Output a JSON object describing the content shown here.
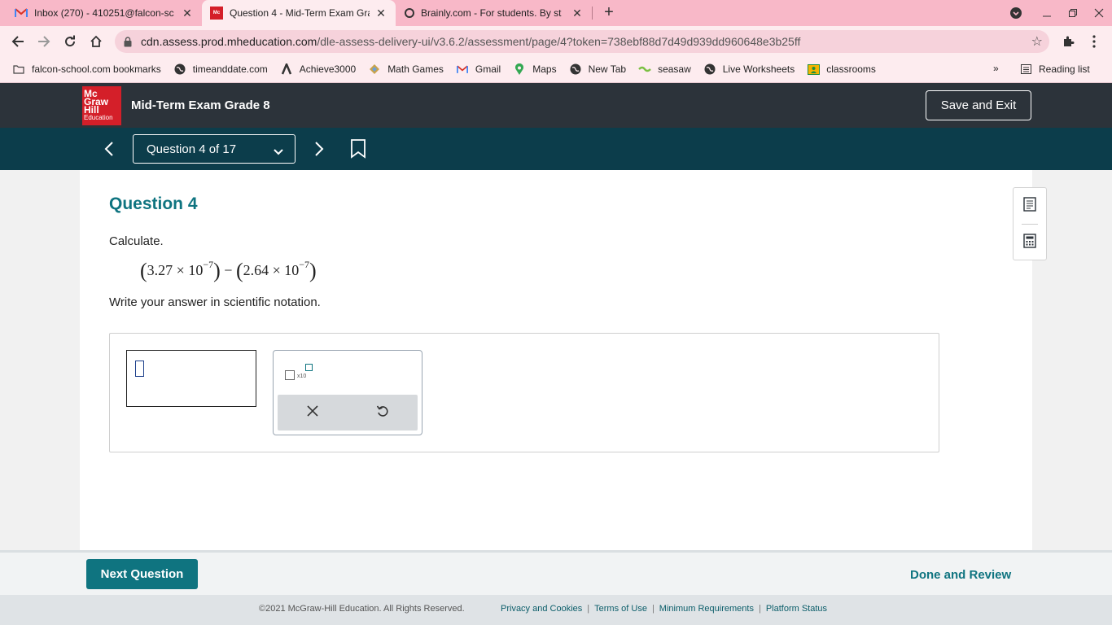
{
  "browser": {
    "tabs": [
      {
        "title": "Inbox (270) - 410251@falcon-sc",
        "favicon": "gmail-icon",
        "active": false
      },
      {
        "title": "Question 4 - Mid-Term Exam Gra",
        "favicon": "mheducation-icon",
        "active": true
      },
      {
        "title": "Brainly.com - For students. By st",
        "favicon": "brainly-icon",
        "active": false
      }
    ],
    "url_host": "cdn.assess.prod.mheducation.com",
    "url_path": "/dle-assess-delivery-ui/v3.6.2/assessment/page/4?token=738ebf88d7d49d939dd960648e3b25ff",
    "bookmarks": [
      {
        "label": "falcon-school.com bookmarks",
        "icon": "folder-icon"
      },
      {
        "label": "timeanddate.com",
        "icon": "globe-icon"
      },
      {
        "label": "Achieve3000",
        "icon": "achieve-icon"
      },
      {
        "label": "Math Games",
        "icon": "math-games-icon"
      },
      {
        "label": "Gmail",
        "icon": "gmail-icon"
      },
      {
        "label": "Maps",
        "icon": "maps-icon"
      },
      {
        "label": "New Tab",
        "icon": "globe-icon"
      },
      {
        "label": "seasaw",
        "icon": "seesaw-icon"
      },
      {
        "label": "Live Worksheets",
        "icon": "globe-icon"
      },
      {
        "label": "classrooms",
        "icon": "classroom-icon"
      }
    ],
    "overflow_label": "»",
    "reading_list": "Reading list"
  },
  "header": {
    "logo_lines": [
      "Mc",
      "Graw",
      "Hill",
      "Education"
    ],
    "exam_title": "Mid-Term Exam Grade 8",
    "save_exit_label": "Save and Exit"
  },
  "qnav": {
    "selector_label": "Question 4 of 17"
  },
  "question": {
    "heading": "Question 4",
    "prompt": "Calculate.",
    "expression": {
      "a_mantissa": "3.27",
      "b_mantissa": "2.64",
      "times": "×",
      "base": "10",
      "exponent": "−7",
      "minus": "−"
    },
    "instruction": "Write your answer in scientific notation.",
    "keypad_sci_label": "x10"
  },
  "footer": {
    "next_label": "Next Question",
    "done_label": "Done and Review",
    "copyright": "©2021 McGraw-Hill Education. All Rights Reserved.",
    "links": [
      "Privacy and Cookies",
      "Terms of Use",
      "Minimum Requirements",
      "Platform Status"
    ]
  },
  "colors": {
    "teal": "#0f7480",
    "header_dark": "#2c333a",
    "nav_teal": "#0c3d4b",
    "brand_red": "#d41f29",
    "tabstrip_pink": "#f8b8c8"
  }
}
